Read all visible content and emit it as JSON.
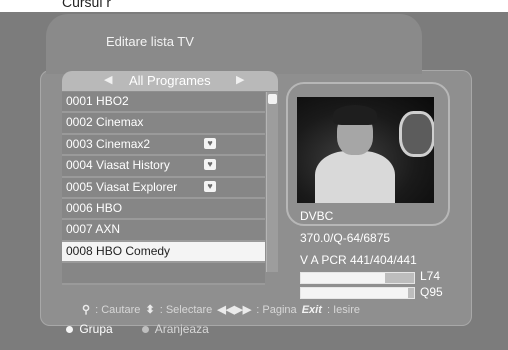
{
  "caption": "Cursul r",
  "window": {
    "title": "Editare lista TV"
  },
  "list": {
    "header": "All Programes",
    "channels": [
      {
        "label": "0001 HBO2",
        "fav": false,
        "selected": false
      },
      {
        "label": "0002 Cinemax",
        "fav": false,
        "selected": false
      },
      {
        "label": "0003 Cinemax2",
        "fav": true,
        "selected": false
      },
      {
        "label": "0004 Viasat History",
        "fav": true,
        "selected": false
      },
      {
        "label": "0005 Viasat Explorer",
        "fav": true,
        "selected": false
      },
      {
        "label": "0006 HBO",
        "fav": false,
        "selected": false
      },
      {
        "label": "0007 AXN",
        "fav": false,
        "selected": false
      },
      {
        "label": "0008 HBO Comedy",
        "fav": false,
        "selected": true
      },
      {
        "label": "",
        "fav": false,
        "selected": false
      }
    ]
  },
  "info": {
    "type": "DVBC",
    "freq": "370.0/Q-64/6875",
    "pids": "V A PCR 441/404/441",
    "level_label": "L74",
    "quality_label": "Q95",
    "level_fraction": 0.74,
    "quality_fraction": 0.95
  },
  "hints": {
    "search": ": Cautare",
    "select": ": Selectare",
    "page": ": Pagina",
    "exit_key": "Exit",
    "exit": ": Iesire"
  },
  "bottom": {
    "grupa": "Grupa",
    "aranjeaza": "Aranjeaza"
  }
}
